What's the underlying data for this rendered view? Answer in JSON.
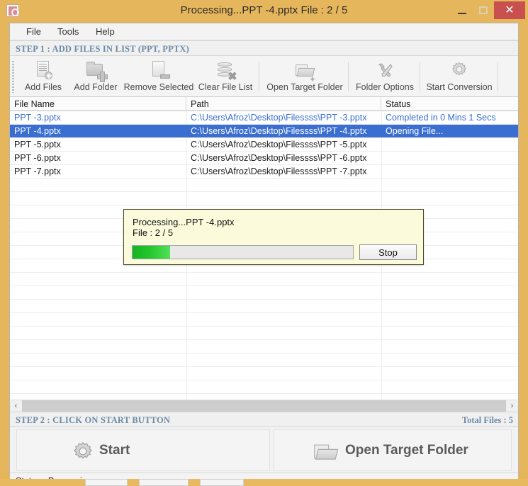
{
  "window": {
    "title": "Processing...PPT -4.pptx File : 2 / 5",
    "app_icon": "app-document-icon",
    "minimize_label": "–",
    "maximize_label": "□",
    "close_label": "✕",
    "titlebar_color": "#e6b65c",
    "close_color": "#c8504f"
  },
  "menubar": {
    "items": [
      {
        "label": "File"
      },
      {
        "label": "Tools"
      },
      {
        "label": "Help"
      }
    ]
  },
  "step1": {
    "header": "STEP 1 : ADD FILES IN LIST (PPT, PPTX)",
    "header_color": "#6c8aa6"
  },
  "toolbar": {
    "buttons": [
      {
        "label": "Add Files",
        "icon": "add-files-icon"
      },
      {
        "label": "Add Folder",
        "icon": "add-folder-icon"
      },
      {
        "label": "Remove Selected",
        "icon": "remove-selected-icon"
      },
      {
        "label": "Clear File List",
        "icon": "clear-file-list-icon"
      },
      {
        "label": "Open Target Folder",
        "icon": "open-folder-icon"
      },
      {
        "label": "Folder Options",
        "icon": "tools-wrench-icon"
      },
      {
        "label": "Start Conversion",
        "icon": "gear-icon"
      }
    ]
  },
  "filelist": {
    "columns": [
      "File Name",
      "Path",
      "Status"
    ],
    "rows": [
      {
        "name": "PPT -3.pptx",
        "path": "C:\\Users\\Afroz\\Desktop\\Filessss\\PPT -3.pptx",
        "status": "Completed in 0 Mins 1 Secs",
        "state": "done"
      },
      {
        "name": "PPT -4.pptx",
        "path": "C:\\Users\\Afroz\\Desktop\\Filessss\\PPT -4.pptx",
        "status": "Opening File...",
        "state": "selected"
      },
      {
        "name": "PPT -5.pptx",
        "path": "C:\\Users\\Afroz\\Desktop\\Filessss\\PPT -5.pptx",
        "status": "",
        "state": "pending"
      },
      {
        "name": "PPT -6.pptx",
        "path": "C:\\Users\\Afroz\\Desktop\\Filessss\\PPT -6.pptx",
        "status": "",
        "state": "pending"
      },
      {
        "name": "PPT -7.pptx",
        "path": "C:\\Users\\Afroz\\Desktop\\Filessss\\PPT -7.pptx",
        "status": "",
        "state": "pending"
      }
    ],
    "selected_color": "#3a6ed0",
    "link_color": "#3a6ed0"
  },
  "scrollbar": {
    "left_arrow": "‹",
    "right_arrow": "›"
  },
  "step2": {
    "header": "STEP 2 : CLICK ON START BUTTON",
    "total_files": "Total Files : 5"
  },
  "actions": {
    "start": {
      "label": "Start",
      "icon": "gear-icon"
    },
    "open_target": {
      "label": "Open Target Folder",
      "icon": "open-folder-icon"
    }
  },
  "statusbar": {
    "text": "Status  :  Processing..."
  },
  "dialog": {
    "line1": "Processing...PPT -4.pptx",
    "line2": "File : 2 / 5",
    "stop_label": "Stop",
    "progress_percent": 17,
    "background": "#fbfbdc",
    "fill_color": "#23c62d"
  }
}
